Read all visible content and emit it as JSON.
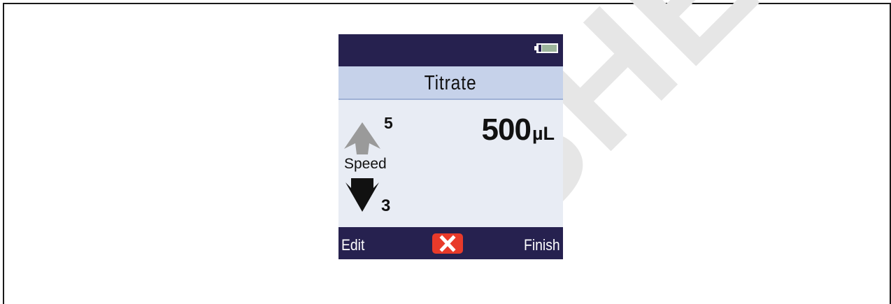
{
  "screen": {
    "title": "Titrate",
    "battery_icon": "battery-icon",
    "speed": {
      "up_icon": "arrow-up-icon",
      "up_value": "5",
      "label": "Speed",
      "down_icon": "arrow-down-icon",
      "down_value": "3"
    },
    "volume": {
      "number": "500",
      "unit": "µL"
    },
    "softkeys": {
      "left_label": "Edit",
      "center_icon": "cancel-x-icon",
      "right_label": "Finish"
    }
  },
  "watermark_text": "SHER SA",
  "colors": {
    "bar_background": "#26214f",
    "title_background": "#c6d2ea",
    "screen_background": "#e8ecf4",
    "cancel_red": "#e83a2a",
    "up_arrow_gray": "#9a9a9a"
  }
}
